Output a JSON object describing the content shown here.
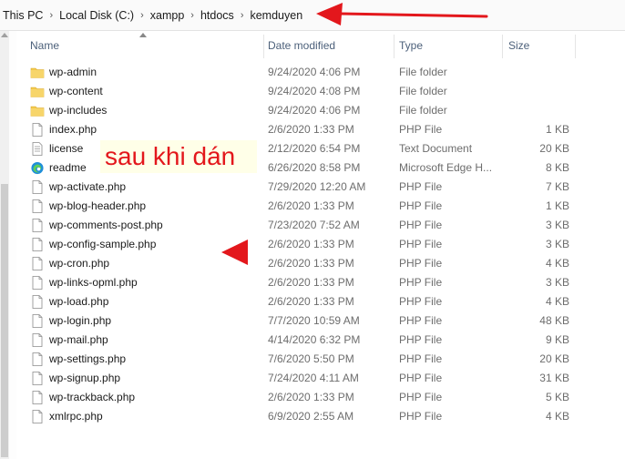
{
  "breadcrumb": [
    {
      "label": "This PC"
    },
    {
      "label": "Local Disk (C:)"
    },
    {
      "label": "xampp"
    },
    {
      "label": "htdocs"
    },
    {
      "label": "kemduyen"
    }
  ],
  "columns": {
    "name": "Name",
    "date": "Date modified",
    "type": "Type",
    "size": "Size"
  },
  "icons": {
    "folder": "folder-icon",
    "file": "file-icon",
    "text": "text-document-icon",
    "edge": "edge-icon"
  },
  "colors": {
    "folder": "#f3c94d",
    "annotation_text": "#e3171c",
    "annotation_bg": "#ffffe8",
    "arrow": "#e3171c",
    "header_text": "#4c607a"
  },
  "files": [
    {
      "name": "wp-admin",
      "date": "9/24/2020 4:06 PM",
      "type": "File folder",
      "size": "",
      "icon": "folder"
    },
    {
      "name": "wp-content",
      "date": "9/24/2020 4:08 PM",
      "type": "File folder",
      "size": "",
      "icon": "folder"
    },
    {
      "name": "wp-includes",
      "date": "9/24/2020 4:06 PM",
      "type": "File folder",
      "size": "",
      "icon": "folder"
    },
    {
      "name": "index.php",
      "date": "2/6/2020 1:33 PM",
      "type": "PHP File",
      "size": "1 KB",
      "icon": "file"
    },
    {
      "name": "license",
      "date": "2/12/2020 6:54 PM",
      "type": "Text Document",
      "size": "20 KB",
      "icon": "text"
    },
    {
      "name": "readme",
      "date": "6/26/2020 8:58 PM",
      "type": "Microsoft Edge H...",
      "size": "8 KB",
      "icon": "edge"
    },
    {
      "name": "wp-activate.php",
      "date": "7/29/2020 12:20 AM",
      "type": "PHP File",
      "size": "7 KB",
      "icon": "file"
    },
    {
      "name": "wp-blog-header.php",
      "date": "2/6/2020 1:33 PM",
      "type": "PHP File",
      "size": "1 KB",
      "icon": "file"
    },
    {
      "name": "wp-comments-post.php",
      "date": "7/23/2020 7:52 AM",
      "type": "PHP File",
      "size": "3 KB",
      "icon": "file"
    },
    {
      "name": "wp-config-sample.php",
      "date": "2/6/2020 1:33 PM",
      "type": "PHP File",
      "size": "3 KB",
      "icon": "file"
    },
    {
      "name": "wp-cron.php",
      "date": "2/6/2020 1:33 PM",
      "type": "PHP File",
      "size": "4 KB",
      "icon": "file"
    },
    {
      "name": "wp-links-opml.php",
      "date": "2/6/2020 1:33 PM",
      "type": "PHP File",
      "size": "3 KB",
      "icon": "file"
    },
    {
      "name": "wp-load.php",
      "date": "2/6/2020 1:33 PM",
      "type": "PHP File",
      "size": "4 KB",
      "icon": "file"
    },
    {
      "name": "wp-login.php",
      "date": "7/7/2020 10:59 AM",
      "type": "PHP File",
      "size": "48 KB",
      "icon": "file"
    },
    {
      "name": "wp-mail.php",
      "date": "4/14/2020 6:32 PM",
      "type": "PHP File",
      "size": "9 KB",
      "icon": "file"
    },
    {
      "name": "wp-settings.php",
      "date": "7/6/2020 5:50 PM",
      "type": "PHP File",
      "size": "20 KB",
      "icon": "file"
    },
    {
      "name": "wp-signup.php",
      "date": "7/24/2020 4:11 AM",
      "type": "PHP File",
      "size": "31 KB",
      "icon": "file"
    },
    {
      "name": "wp-trackback.php",
      "date": "2/6/2020 1:33 PM",
      "type": "PHP File",
      "size": "5 KB",
      "icon": "file"
    },
    {
      "name": "xmlrpc.php",
      "date": "6/9/2020 2:55 AM",
      "type": "PHP File",
      "size": "4 KB",
      "icon": "file"
    }
  ],
  "annotation": {
    "text": "sau khi dán"
  }
}
